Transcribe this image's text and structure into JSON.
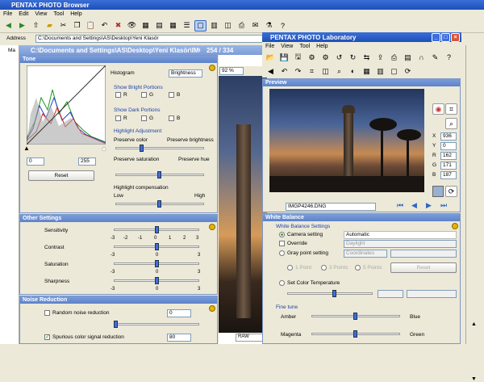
{
  "browser": {
    "title": "PENTAX PHOTO Browser",
    "menu": [
      "File",
      "Edit",
      "View",
      "Tool",
      "Help"
    ],
    "address_label": "Address",
    "address_value": "C:\\Documents and Settings\\AS\\Desktop\\Yeni Klasör",
    "tree_label": "Ma",
    "zoom_value": "92 %",
    "table_header": "RAW"
  },
  "image_window": {
    "title": "C:\\Documents and Settings\\AS\\Desktop\\Yeni Klasör\\IMGP4246.DNG",
    "counter": "254 / 334"
  },
  "tone": {
    "header": "Tone",
    "histogram_label": "Histogram",
    "histogram_mode": "Brightness",
    "bright_label": "Show Bright Portions",
    "dark_label": "Show Dark Portions",
    "ch_r": "R",
    "ch_g": "G",
    "ch_b": "B",
    "highlight_title": "Highlight Adjustment",
    "preserve_color": "Preserve color",
    "preserve_brightness": "Preserve brightness",
    "preserve_saturation": "Preserve saturation",
    "preserve_hue": "Preserve hue",
    "compensation": "Highlight compensation",
    "low": "Low",
    "high": "High",
    "input_low": "0",
    "input_high": "255",
    "reset": "Reset"
  },
  "other": {
    "header": "Other Settings",
    "sensitivity": "Sensitivity",
    "contrast": "Contrast",
    "saturation": "Saturation",
    "sharpness": "Sharpness",
    "scale7": [
      "-3",
      "-2",
      "-1",
      "0",
      "1",
      "2",
      "3"
    ],
    "scale3": [
      "-3",
      "0",
      "3"
    ]
  },
  "noise": {
    "header": "Noise Reduction",
    "random": "Random noise reduction",
    "random_value": "0",
    "spurious": "Spurious color signal reduction",
    "spurious_value": "80"
  },
  "lab": {
    "title": "PENTAX PHOTO Laboratory",
    "menu": [
      "File",
      "View",
      "Tool",
      "Help"
    ]
  },
  "preview": {
    "header": "Preview",
    "filename": "IMGP4246.DNG",
    "readout": [
      {
        "k": "X",
        "v": "936"
      },
      {
        "k": "Y",
        "v": "0"
      },
      {
        "k": "R",
        "v": "162"
      },
      {
        "k": "G",
        "v": "171"
      },
      {
        "k": "B",
        "v": "187"
      }
    ]
  },
  "wb": {
    "header": "White Balance",
    "sub": "White Balance Settings",
    "camera": "Camera setting",
    "camera_value": "Automatic",
    "override": "Override",
    "override_value": "Daylight",
    "gray": "Gray point setting",
    "gray_value": "Coordinates",
    "p1": "1 Point",
    "p3": "3 Points",
    "p5": "5 Points",
    "reset": "Reset",
    "color_temp": "Set Color Temperature",
    "fine": "Fine tune",
    "amber": "Amber",
    "blue": "Blue",
    "magenta": "Magenta",
    "green": "Green"
  }
}
